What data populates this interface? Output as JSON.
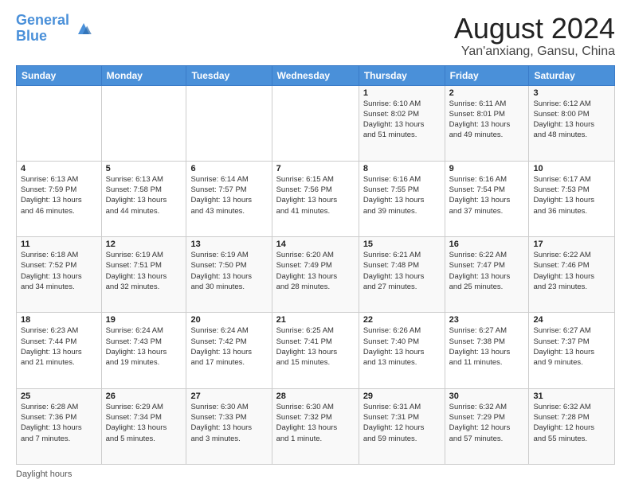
{
  "header": {
    "logo_line1": "General",
    "logo_line2": "Blue",
    "title": "August 2024",
    "subtitle": "Yan'anxiang, Gansu, China"
  },
  "weekdays": [
    "Sunday",
    "Monday",
    "Tuesday",
    "Wednesday",
    "Thursday",
    "Friday",
    "Saturday"
  ],
  "weeks": [
    [
      {
        "day": "",
        "info": ""
      },
      {
        "day": "",
        "info": ""
      },
      {
        "day": "",
        "info": ""
      },
      {
        "day": "",
        "info": ""
      },
      {
        "day": "1",
        "info": "Sunrise: 6:10 AM\nSunset: 8:02 PM\nDaylight: 13 hours\nand 51 minutes."
      },
      {
        "day": "2",
        "info": "Sunrise: 6:11 AM\nSunset: 8:01 PM\nDaylight: 13 hours\nand 49 minutes."
      },
      {
        "day": "3",
        "info": "Sunrise: 6:12 AM\nSunset: 8:00 PM\nDaylight: 13 hours\nand 48 minutes."
      }
    ],
    [
      {
        "day": "4",
        "info": "Sunrise: 6:13 AM\nSunset: 7:59 PM\nDaylight: 13 hours\nand 46 minutes."
      },
      {
        "day": "5",
        "info": "Sunrise: 6:13 AM\nSunset: 7:58 PM\nDaylight: 13 hours\nand 44 minutes."
      },
      {
        "day": "6",
        "info": "Sunrise: 6:14 AM\nSunset: 7:57 PM\nDaylight: 13 hours\nand 43 minutes."
      },
      {
        "day": "7",
        "info": "Sunrise: 6:15 AM\nSunset: 7:56 PM\nDaylight: 13 hours\nand 41 minutes."
      },
      {
        "day": "8",
        "info": "Sunrise: 6:16 AM\nSunset: 7:55 PM\nDaylight: 13 hours\nand 39 minutes."
      },
      {
        "day": "9",
        "info": "Sunrise: 6:16 AM\nSunset: 7:54 PM\nDaylight: 13 hours\nand 37 minutes."
      },
      {
        "day": "10",
        "info": "Sunrise: 6:17 AM\nSunset: 7:53 PM\nDaylight: 13 hours\nand 36 minutes."
      }
    ],
    [
      {
        "day": "11",
        "info": "Sunrise: 6:18 AM\nSunset: 7:52 PM\nDaylight: 13 hours\nand 34 minutes."
      },
      {
        "day": "12",
        "info": "Sunrise: 6:19 AM\nSunset: 7:51 PM\nDaylight: 13 hours\nand 32 minutes."
      },
      {
        "day": "13",
        "info": "Sunrise: 6:19 AM\nSunset: 7:50 PM\nDaylight: 13 hours\nand 30 minutes."
      },
      {
        "day": "14",
        "info": "Sunrise: 6:20 AM\nSunset: 7:49 PM\nDaylight: 13 hours\nand 28 minutes."
      },
      {
        "day": "15",
        "info": "Sunrise: 6:21 AM\nSunset: 7:48 PM\nDaylight: 13 hours\nand 27 minutes."
      },
      {
        "day": "16",
        "info": "Sunrise: 6:22 AM\nSunset: 7:47 PM\nDaylight: 13 hours\nand 25 minutes."
      },
      {
        "day": "17",
        "info": "Sunrise: 6:22 AM\nSunset: 7:46 PM\nDaylight: 13 hours\nand 23 minutes."
      }
    ],
    [
      {
        "day": "18",
        "info": "Sunrise: 6:23 AM\nSunset: 7:44 PM\nDaylight: 13 hours\nand 21 minutes."
      },
      {
        "day": "19",
        "info": "Sunrise: 6:24 AM\nSunset: 7:43 PM\nDaylight: 13 hours\nand 19 minutes."
      },
      {
        "day": "20",
        "info": "Sunrise: 6:24 AM\nSunset: 7:42 PM\nDaylight: 13 hours\nand 17 minutes."
      },
      {
        "day": "21",
        "info": "Sunrise: 6:25 AM\nSunset: 7:41 PM\nDaylight: 13 hours\nand 15 minutes."
      },
      {
        "day": "22",
        "info": "Sunrise: 6:26 AM\nSunset: 7:40 PM\nDaylight: 13 hours\nand 13 minutes."
      },
      {
        "day": "23",
        "info": "Sunrise: 6:27 AM\nSunset: 7:38 PM\nDaylight: 13 hours\nand 11 minutes."
      },
      {
        "day": "24",
        "info": "Sunrise: 6:27 AM\nSunset: 7:37 PM\nDaylight: 13 hours\nand 9 minutes."
      }
    ],
    [
      {
        "day": "25",
        "info": "Sunrise: 6:28 AM\nSunset: 7:36 PM\nDaylight: 13 hours\nand 7 minutes."
      },
      {
        "day": "26",
        "info": "Sunrise: 6:29 AM\nSunset: 7:34 PM\nDaylight: 13 hours\nand 5 minutes."
      },
      {
        "day": "27",
        "info": "Sunrise: 6:30 AM\nSunset: 7:33 PM\nDaylight: 13 hours\nand 3 minutes."
      },
      {
        "day": "28",
        "info": "Sunrise: 6:30 AM\nSunset: 7:32 PM\nDaylight: 13 hours\nand 1 minute."
      },
      {
        "day": "29",
        "info": "Sunrise: 6:31 AM\nSunset: 7:31 PM\nDaylight: 12 hours\nand 59 minutes."
      },
      {
        "day": "30",
        "info": "Sunrise: 6:32 AM\nSunset: 7:29 PM\nDaylight: 12 hours\nand 57 minutes."
      },
      {
        "day": "31",
        "info": "Sunrise: 6:32 AM\nSunset: 7:28 PM\nDaylight: 12 hours\nand 55 minutes."
      }
    ]
  ],
  "footer": {
    "label": "Daylight hours"
  }
}
